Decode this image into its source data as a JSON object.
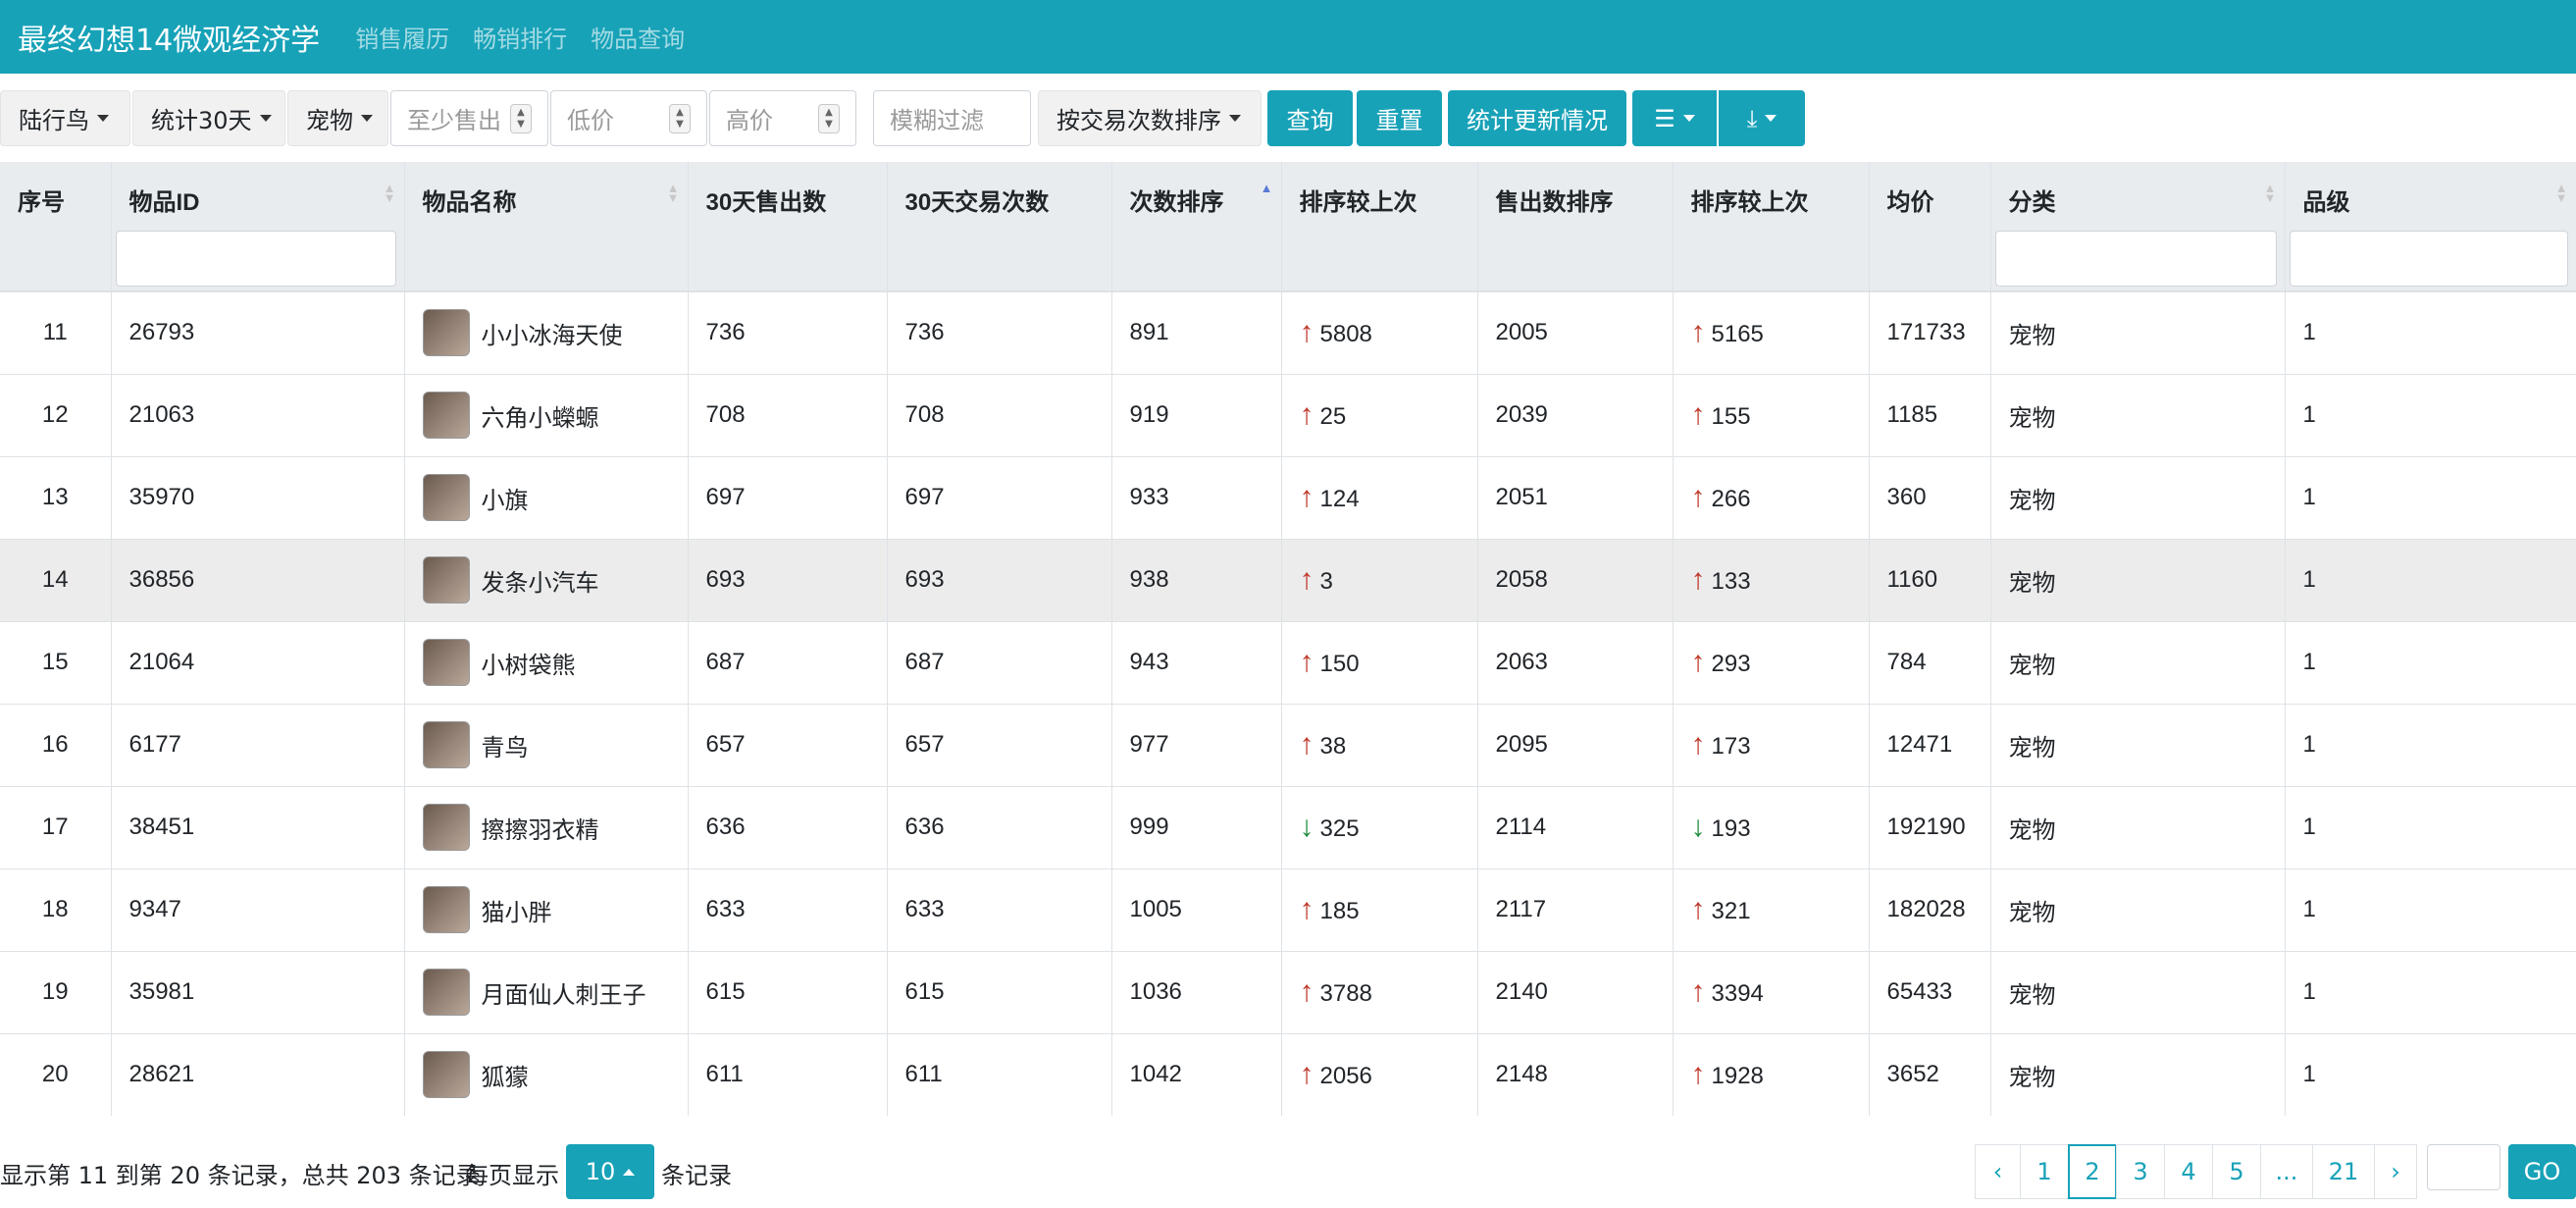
{
  "brand": "最终幻想14微观经济学",
  "nav": [
    "销售履历",
    "畅销排行",
    "物品查询"
  ],
  "toolbar": {
    "server": "陆行鸟",
    "period": "统计30天",
    "category": "宠物",
    "min_sold_placeholder": "至少售出",
    "low_price_placeholder": "低价",
    "high_price_placeholder": "高价",
    "fuzzy_placeholder": "模糊过滤",
    "sort": "按交易次数排序",
    "query_btn": "查询",
    "reset_btn": "重置",
    "stats_btn": "统计更新情况",
    "list_icon": "list-icon",
    "download_icon": "download-icon"
  },
  "table": {
    "headers": [
      "序号",
      "物品ID",
      "物品名称",
      "30天售出数",
      "30天交易次数",
      "次数排序",
      "排序较上次",
      "售出数排序",
      "排序较上次",
      "均价",
      "分类",
      "品级"
    ],
    "sorted_column": "次数排序",
    "rows": [
      {
        "no": "11",
        "id": "26793",
        "name": "小小冰海天使",
        "sold": "736",
        "trades": "736",
        "rank": "891",
        "rank_dir": "up",
        "rank_delta": "5808",
        "sold_rank": "2005",
        "sold_dir": "up",
        "sold_delta": "5165",
        "avg": "171733",
        "cat": "宠物",
        "grade": "1"
      },
      {
        "no": "12",
        "id": "21063",
        "name": "六角小蠑螈",
        "sold": "708",
        "trades": "708",
        "rank": "919",
        "rank_dir": "up",
        "rank_delta": "25",
        "sold_rank": "2039",
        "sold_dir": "up",
        "sold_delta": "155",
        "avg": "1185",
        "cat": "宠物",
        "grade": "1"
      },
      {
        "no": "13",
        "id": "35970",
        "name": "小旗",
        "sold": "697",
        "trades": "697",
        "rank": "933",
        "rank_dir": "up",
        "rank_delta": "124",
        "sold_rank": "2051",
        "sold_dir": "up",
        "sold_delta": "266",
        "avg": "360",
        "cat": "宠物",
        "grade": "1"
      },
      {
        "no": "14",
        "id": "36856",
        "name": "发条小汽车",
        "sold": "693",
        "trades": "693",
        "rank": "938",
        "rank_dir": "up",
        "rank_delta": "3",
        "sold_rank": "2058",
        "sold_dir": "up",
        "sold_delta": "133",
        "avg": "1160",
        "cat": "宠物",
        "grade": "1"
      },
      {
        "no": "15",
        "id": "21064",
        "name": "小树袋熊",
        "sold": "687",
        "trades": "687",
        "rank": "943",
        "rank_dir": "up",
        "rank_delta": "150",
        "sold_rank": "2063",
        "sold_dir": "up",
        "sold_delta": "293",
        "avg": "784",
        "cat": "宠物",
        "grade": "1"
      },
      {
        "no": "16",
        "id": "6177",
        "name": "青鸟",
        "sold": "657",
        "trades": "657",
        "rank": "977",
        "rank_dir": "up",
        "rank_delta": "38",
        "sold_rank": "2095",
        "sold_dir": "up",
        "sold_delta": "173",
        "avg": "12471",
        "cat": "宠物",
        "grade": "1"
      },
      {
        "no": "17",
        "id": "38451",
        "name": "擦擦羽衣精",
        "sold": "636",
        "trades": "636",
        "rank": "999",
        "rank_dir": "down",
        "rank_delta": "325",
        "sold_rank": "2114",
        "sold_dir": "down",
        "sold_delta": "193",
        "avg": "192190",
        "cat": "宠物",
        "grade": "1"
      },
      {
        "no": "18",
        "id": "9347",
        "name": "猫小胖",
        "sold": "633",
        "trades": "633",
        "rank": "1005",
        "rank_dir": "up",
        "rank_delta": "185",
        "sold_rank": "2117",
        "sold_dir": "up",
        "sold_delta": "321",
        "avg": "182028",
        "cat": "宠物",
        "grade": "1"
      },
      {
        "no": "19",
        "id": "35981",
        "name": "月面仙人刺王子",
        "sold": "615",
        "trades": "615",
        "rank": "1036",
        "rank_dir": "up",
        "rank_delta": "3788",
        "sold_rank": "2140",
        "sold_dir": "up",
        "sold_delta": "3394",
        "avg": "65433",
        "cat": "宠物",
        "grade": "1"
      },
      {
        "no": "20",
        "id": "28621",
        "name": "狐獴",
        "sold": "611",
        "trades": "611",
        "rank": "1042",
        "rank_dir": "up",
        "rank_delta": "2056",
        "sold_rank": "2148",
        "sold_dir": "up",
        "sold_delta": "1928",
        "avg": "3652",
        "cat": "宠物",
        "grade": "1"
      }
    ]
  },
  "footer": {
    "summary": "显示第 11 到第 20 条记录，总共 203 条记录",
    "per_page_prefix": "每页显示",
    "per_page": "10",
    "per_page_suffix": "条记录",
    "pages": [
      "‹",
      "1",
      "2",
      "3",
      "4",
      "5",
      "...",
      "21",
      "›"
    ],
    "active_page": "2",
    "go": "GO"
  },
  "colors": {
    "accent": "#17a2b8",
    "up": "#c0392b",
    "down": "#1e8b3d"
  }
}
